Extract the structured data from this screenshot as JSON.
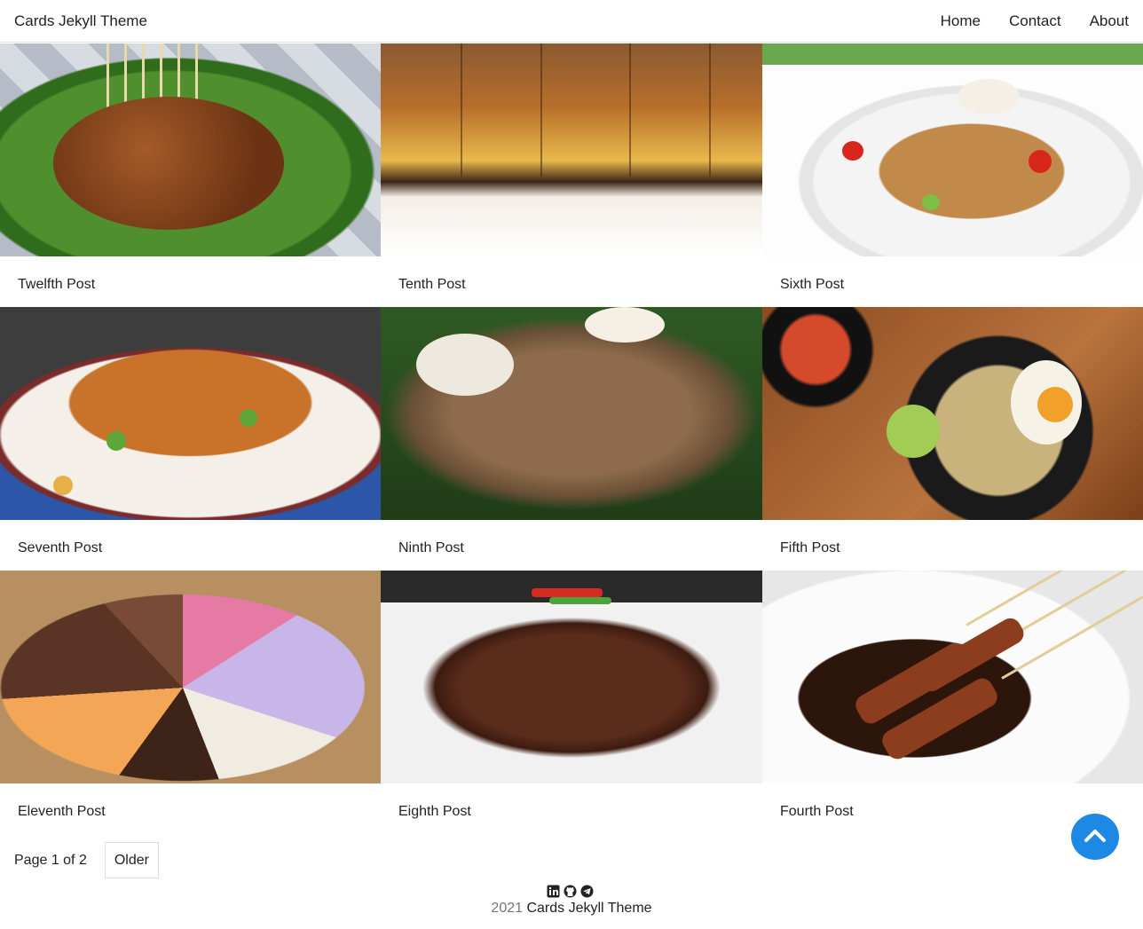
{
  "header": {
    "brand": "Cards Jekyll Theme",
    "nav": [
      "Home",
      "Contact",
      "About"
    ]
  },
  "posts": [
    {
      "title": "Twelfth Post",
      "image": "satay-with-peanut-sauce"
    },
    {
      "title": "Tenth Post",
      "image": "martabak"
    },
    {
      "title": "Sixth Post",
      "image": "fried-rice"
    },
    {
      "title": "Seventh Post",
      "image": "fried-noodles"
    },
    {
      "title": "Ninth Post",
      "image": "salad-with-crackers"
    },
    {
      "title": "Fifth Post",
      "image": "soup-with-egg"
    },
    {
      "title": "Eleventh Post",
      "image": "toppings-pancake"
    },
    {
      "title": "Eighth Post",
      "image": "rendang"
    },
    {
      "title": "Fourth Post",
      "image": "satay-in-soy-sauce"
    }
  ],
  "pagination": {
    "info": "Page 1 of 2",
    "older_label": "Older"
  },
  "social_icons": [
    "linkedin-icon",
    "github-icon",
    "telegram-icon"
  ],
  "footer": {
    "year": "2021",
    "name": "Cards Jekyll Theme"
  },
  "colors": {
    "accent": "#1e88e5",
    "text": "#222222",
    "muted": "#777777"
  }
}
